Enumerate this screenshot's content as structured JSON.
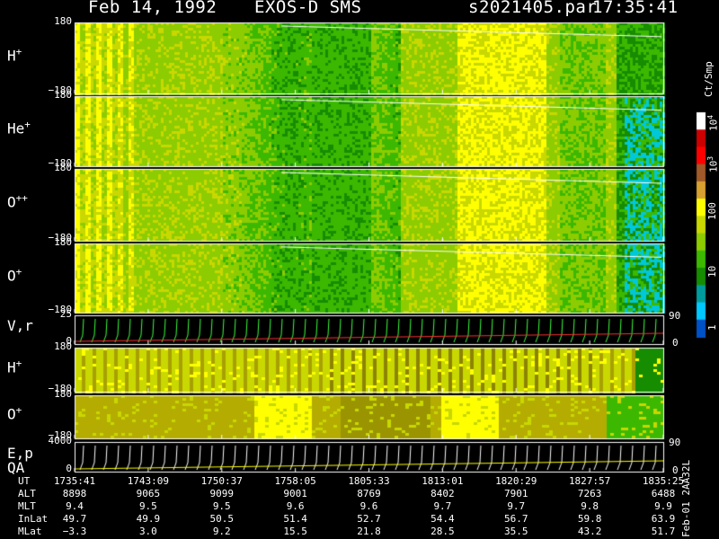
{
  "header": {
    "date": "Feb 14, 1992",
    "instrument": "EXOS-D SMS",
    "file": "s2021405.par",
    "time": "17:35:41"
  },
  "panels": [
    {
      "label": "H",
      "sup": "+",
      "top": "180",
      "bottom": "−180"
    },
    {
      "label": "He",
      "sup": "+",
      "top": "180",
      "bottom": "−180"
    },
    {
      "label": "O",
      "sup": "++",
      "top": "180",
      "bottom": "−180"
    },
    {
      "label": "O",
      "sup": "+",
      "top": "180",
      "bottom": "−180"
    },
    {
      "label": "V,r",
      "sup": "",
      "top": "25",
      "bottom": "0",
      "right_top": "90",
      "right_bottom": "0"
    },
    {
      "label": "H",
      "sup": "+",
      "top": "180",
      "bottom": "−180"
    },
    {
      "label": "O",
      "sup": "+",
      "top": "180",
      "bottom": "−180"
    },
    {
      "label": "E,p",
      "sup": "",
      "label2": "QA",
      "top": "4000",
      "bottom": "0",
      "right_top": "90",
      "right_bottom": "0"
    }
  ],
  "colorbar": {
    "unit": "Ct/Smp",
    "labels": [
      {
        "base": "10",
        "exp": "4"
      },
      {
        "base": "10",
        "exp": "3"
      },
      {
        "base": "100",
        "exp": ""
      },
      {
        "base": "10",
        "exp": ""
      },
      {
        "base": "1",
        "exp": ""
      }
    ],
    "colors": [
      "#ffffff",
      "#cc0000",
      "#ff0000",
      "#a05a2a",
      "#d8a030",
      "#ffff00",
      "#c8d800",
      "#8ccc00",
      "#3cb800",
      "#168c00",
      "#009c9c",
      "#00c8ff",
      "#0050c8"
    ]
  },
  "footer": {
    "rows": [
      {
        "name": "UT",
        "values": [
          "1735:41",
          "1743:09",
          "1750:37",
          "1758:05",
          "1805:33",
          "1813:01",
          "1820:29",
          "1827:57",
          "1835:25"
        ]
      },
      {
        "name": "ALT",
        "values": [
          "8898",
          "9065",
          "9099",
          "9001",
          "8769",
          "8402",
          "7901",
          "7263",
          "6488"
        ]
      },
      {
        "name": "MLT",
        "values": [
          "9.4",
          "9.5",
          "9.5",
          "9.6",
          "9.6",
          "9.7",
          "9.7",
          "9.8",
          "9.9"
        ]
      },
      {
        "name": "InLat",
        "values": [
          "49.7",
          "49.9",
          "50.5",
          "51.4",
          "52.7",
          "54.4",
          "56.7",
          "59.8",
          "63.9"
        ]
      },
      {
        "name": "MLat",
        "values": [
          "−3.3",
          "3.0",
          "9.2",
          "15.5",
          "21.8",
          "28.5",
          "35.5",
          "43.2",
          "51.7"
        ]
      }
    ],
    "side_label": "Feb-01 2AA32L"
  },
  "chart_data": {
    "type": "heatmap",
    "title": "Feb 14, 1992  EXOS-D SMS  s2021405.par 17:35:41",
    "x_ticks": [
      "1735:41",
      "1743:09",
      "1750:37",
      "1758:05",
      "1805:33",
      "1813:01",
      "1820:29",
      "1827:57",
      "1835:25"
    ],
    "panels": [
      "H+",
      "He+",
      "O++",
      "O+",
      "V,r",
      "H+",
      "O+",
      "E,p QA"
    ],
    "ylim_angle": [
      -180,
      180
    ],
    "colorbar_unit": "Ct/Smp",
    "colorbar_range": [
      1,
      10000
    ]
  }
}
